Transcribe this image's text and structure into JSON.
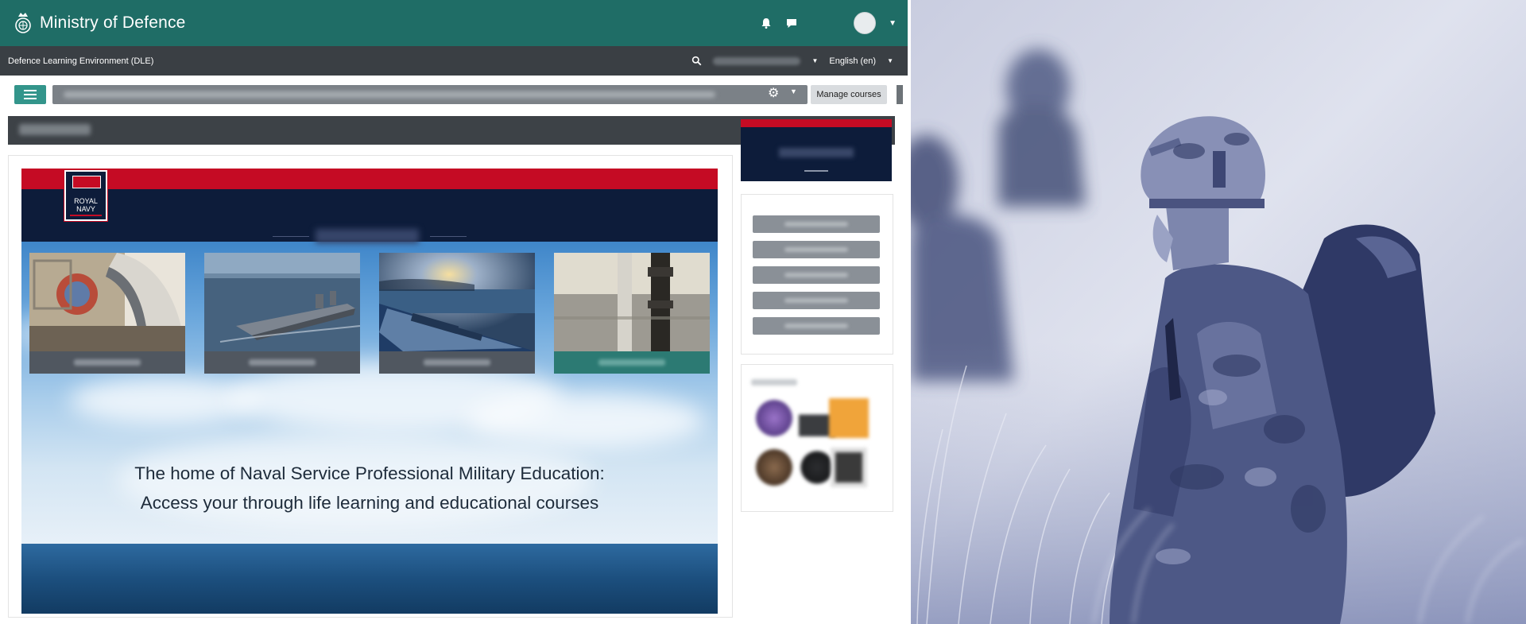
{
  "site": {
    "brand_name": "Ministry of Defence",
    "env_title": "Defence Learning Environment (DLE)",
    "language": "English (en)",
    "manage_courses_label": "Manage courses"
  },
  "banner": {
    "logo_line1": "ROYAL",
    "logo_line2": "NAVY",
    "tagline_line1": "The home of Naval Service Professional Military Education:",
    "tagline_line2": "Access your through life learning and educational courses"
  },
  "colors": {
    "topbar": "#1f6d66",
    "navbar": "#3a3f44",
    "accent_teal": "#33958b",
    "rn_red": "#c50b24",
    "rn_navy": "#0d1c3a",
    "photo_tint": "#2d3a7a"
  },
  "icons": {
    "crest": "mod-crest-icon",
    "bell": "bell-icon",
    "chat": "chat-icon",
    "search": "search-icon",
    "menu": "hamburger-icon",
    "settings": "gear-icon"
  }
}
